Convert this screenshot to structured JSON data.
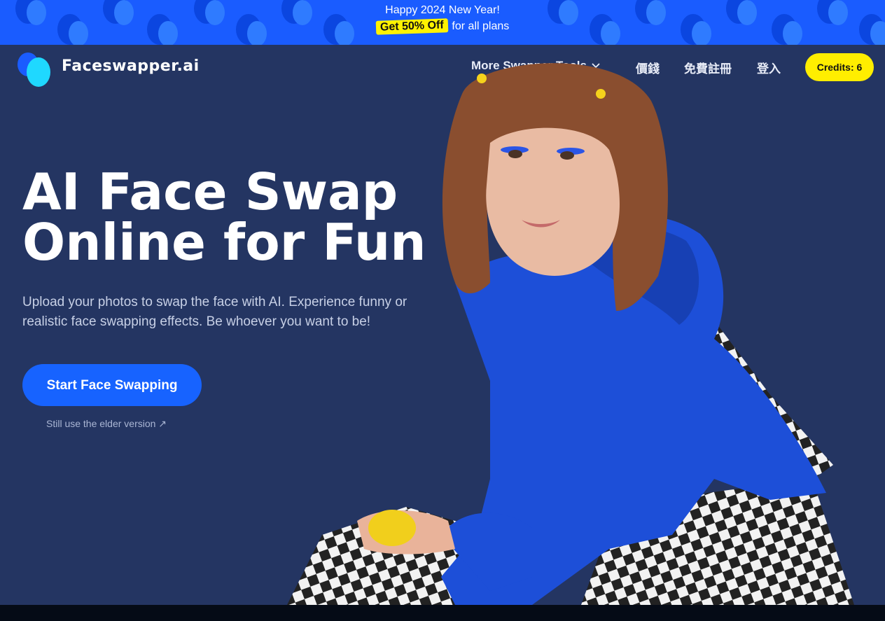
{
  "promo": {
    "line1": "Happy 2024 New Year!",
    "badge": "Get 50% Off",
    "line2_rest": "for all plans"
  },
  "header": {
    "logo_text": "Faceswapper.ai",
    "nav": {
      "more_tools": "More Swapper Tools",
      "pricing": "價錢",
      "signup": "免費註冊",
      "login": "登入"
    },
    "credits": "Credits: 6"
  },
  "hero": {
    "title_line1": "AI Face Swap",
    "title_line2": "Online for Fun",
    "subtitle_line1": "Upload your photos to swap the face with AI. Experience funny or",
    "subtitle_line2": "realistic face swapping effects. Be whoever you want to be!",
    "cta_label": "Start Face Swapping",
    "elder_link": "Still use the elder version ↗"
  },
  "colors": {
    "page_bg": "#243562",
    "promo_bg": "#1a5cff",
    "accent_yellow": "#ffee00",
    "cta_blue": "#1763ff"
  },
  "icons": {
    "logo": "logo-mark-icon",
    "dropdown": "chevron-down-icon"
  }
}
